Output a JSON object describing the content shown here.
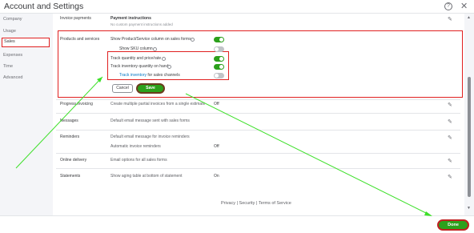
{
  "window": {
    "title": "Account and Settings",
    "help_icon": "help-icon",
    "close_icon": "close-icon",
    "help_glyph": "?",
    "close_glyph": "✕"
  },
  "sidebar": {
    "items": [
      {
        "label": "Company"
      },
      {
        "label": "Usage"
      },
      {
        "label": "Sales"
      },
      {
        "label": "Expenses"
      },
      {
        "label": "Time"
      },
      {
        "label": "Advanced"
      }
    ],
    "active": "Sales"
  },
  "sections": {
    "invoice_payments": {
      "label": "Invoice payments",
      "title": "Payment instructions",
      "detail": "No custom payment instructions added"
    },
    "products": {
      "label": "Products and services",
      "rows": [
        {
          "text": "Show Product/Service column on sales forms",
          "state": "on"
        },
        {
          "text": "Show SKU column",
          "state": "off"
        },
        {
          "text": "Track quantity and price/rate",
          "state": "on"
        },
        {
          "text": "Track inventory quantity on hand",
          "state": "on"
        },
        {
          "text_link": "Track inventory",
          "text_rest": " for sales channels",
          "state": "off"
        }
      ],
      "cancel_label": "Cancel",
      "save_label": "Save"
    },
    "progress_invoicing": {
      "label": "Progress invoicing",
      "desc": "Create multiple partial invoices from a single estimate",
      "value": "Off"
    },
    "messages": {
      "label": "Messages",
      "desc": "Default email message sent with sales forms"
    },
    "reminders": {
      "label": "Reminders",
      "desc": "Default email message for invoice reminders",
      "desc2": "Automatic invoice reminders",
      "value": "Off"
    },
    "online_delivery": {
      "label": "Online delivery",
      "desc": "Email options for all sales forms"
    },
    "statements": {
      "label": "Statements",
      "desc": "Show aging table at bottom of statement",
      "value": "On"
    }
  },
  "footer_links": {
    "privacy": "Privacy",
    "security": "Security",
    "terms": "Terms of Service",
    "divider": "|"
  },
  "footer": {
    "done_label": "Done"
  },
  "colors": {
    "accent_green": "#2ca01c",
    "highlight_red": "#e02020",
    "arrow_green": "#3ee02a"
  }
}
